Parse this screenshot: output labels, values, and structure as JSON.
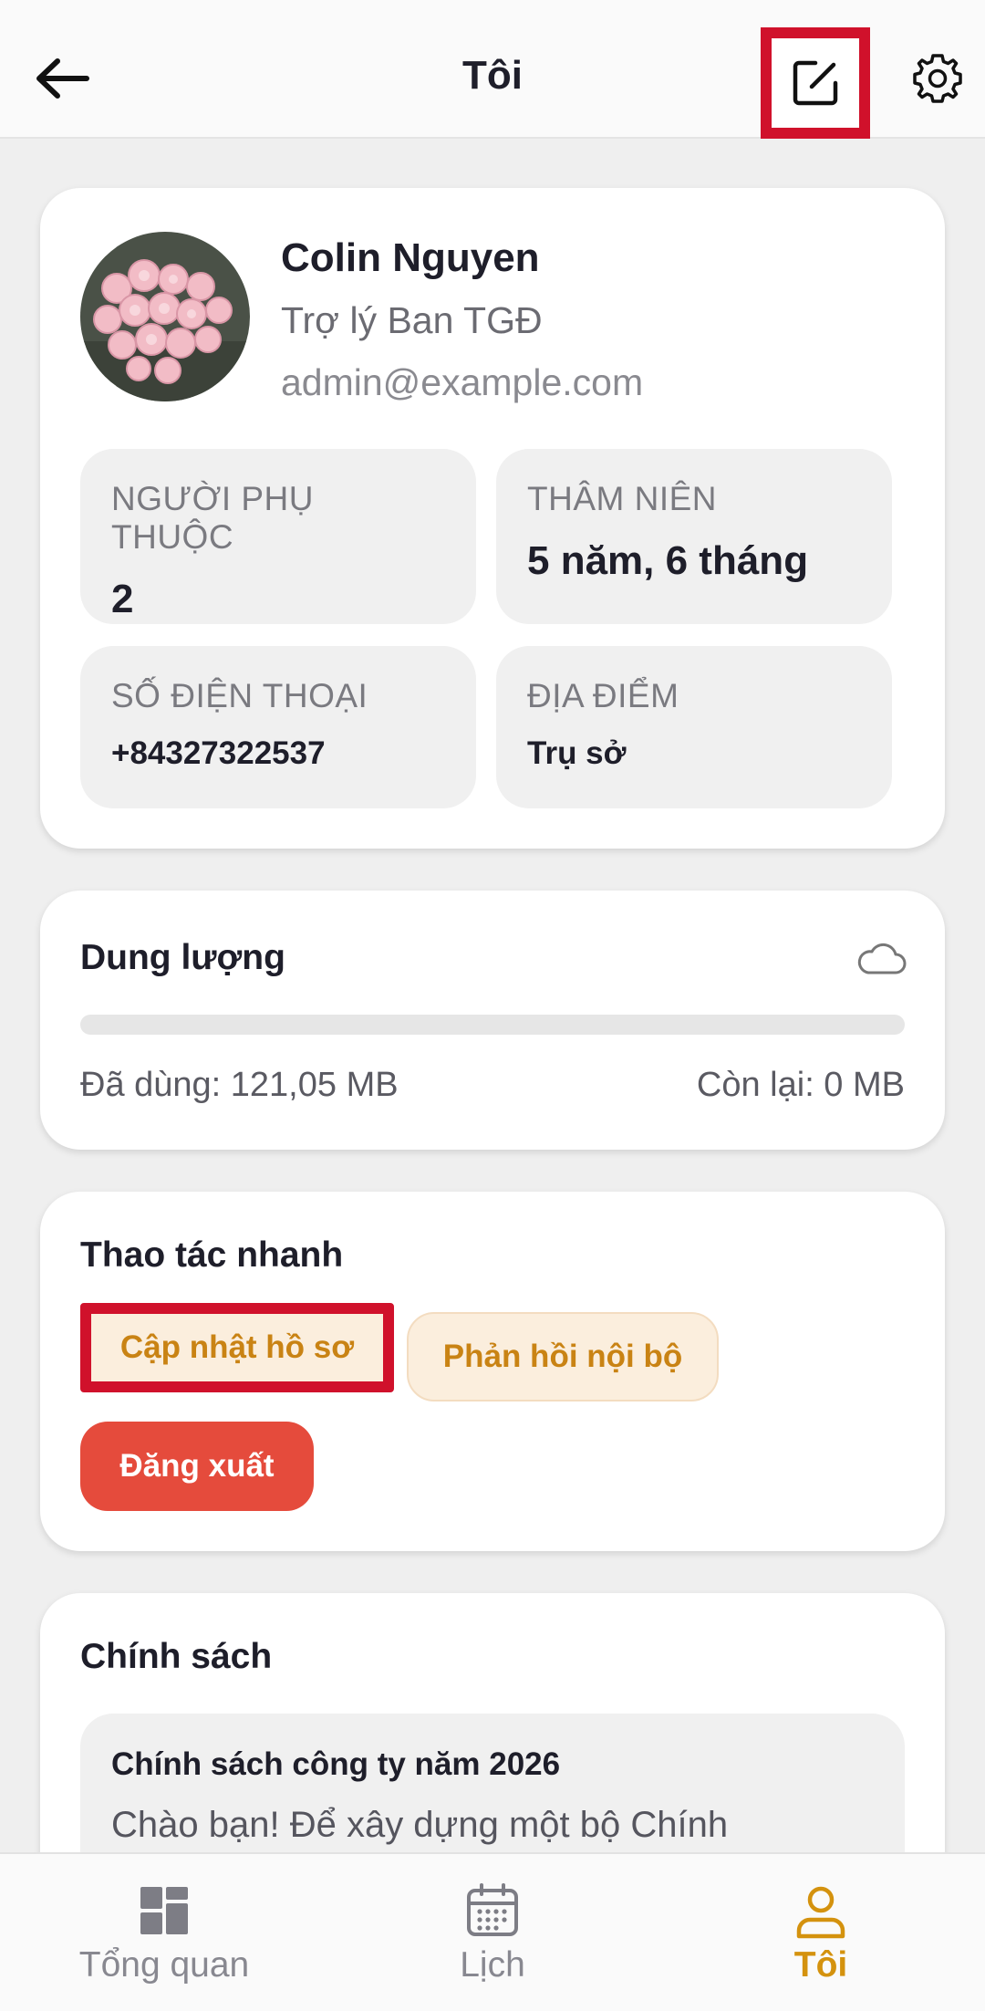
{
  "header": {
    "title": "Tôi",
    "back_icon": "arrow-left-icon",
    "edit_icon": "edit-square-icon",
    "settings_icon": "gear-icon"
  },
  "profile": {
    "name": "Colin Nguyen",
    "role": "Trợ lý Ban TGĐ",
    "email": "admin@example.com",
    "avatar": "pink-roses-photo",
    "info": [
      {
        "label": "NGƯỜI PHỤ THUỘC",
        "value": "2"
      },
      {
        "label": "THÂM NIÊN",
        "value": "5 năm, 6 tháng"
      },
      {
        "label": "SỐ ĐIỆN THOẠI",
        "value": "+84327322537"
      },
      {
        "label": "ĐỊA ĐIỂM",
        "value": "Trụ sở"
      }
    ]
  },
  "storage": {
    "title": "Dung lượng",
    "icon": "cloud-icon",
    "used": "Đã dùng: 121,05 MB",
    "remaining": "Còn lại: 0 MB",
    "usage_fraction": 0
  },
  "actions": {
    "title": "Thao tác nhanh",
    "update_profile": "Cập nhật hồ sơ",
    "feedback": "Phản hồi nội bộ",
    "logout": "Đăng xuất"
  },
  "policy": {
    "title": "Chính sách",
    "item_title": "Chính sách công ty năm 2026",
    "item_text": "Chào bạn! Để xây dựng một bộ Chính"
  },
  "nav": {
    "items": [
      {
        "label": "Tổng quan",
        "icon": "dashboard-grid-icon"
      },
      {
        "label": "Lịch",
        "icon": "calendar-icon"
      },
      {
        "label": "Tôi",
        "icon": "user-icon"
      }
    ]
  },
  "colors": {
    "accent": "#d4920e",
    "highlight_border": "#d0112b",
    "logout": "#e54b3c"
  }
}
